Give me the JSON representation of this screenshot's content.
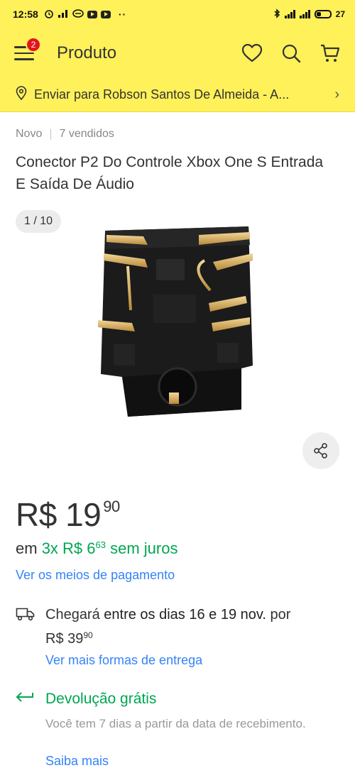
{
  "status_bar": {
    "time": "12:58",
    "battery": "27"
  },
  "header": {
    "menu_badge": "2",
    "title": "Produto"
  },
  "address": {
    "text": "Enviar para Robson Santos De Almeida - A...",
    "chevron": "›"
  },
  "product": {
    "condition": "Novo",
    "separator": "|",
    "sold": "7 vendidos",
    "title": "Conector P2 Do Controle Xbox One S Entrada E Saída De Áudio",
    "image_counter": "1 / 10"
  },
  "price": {
    "main": "R$ 19",
    "cents": "90"
  },
  "installments": {
    "prefix": "em ",
    "amount": "3x R$ 6",
    "cents": "63",
    "suffix": " sem juros"
  },
  "payment_link": "Ver os meios de pagamento",
  "delivery": {
    "prefix": "Chegará ",
    "dates": "entre os dias 16 e 19 nov.",
    "mid": " por",
    "price": "R$ 39",
    "cents": "90",
    "link": "Ver mais formas de entrega"
  },
  "returns": {
    "label": "Devolução grátis",
    "description": "Você tem 7 dias a partir da data de recebimento.",
    "link": "Saiba mais"
  },
  "icons": {
    "menu": "hamburger-icon",
    "favorite": "heart-icon",
    "search": "search-icon",
    "cart": "cart-icon",
    "location": "location-pin-icon",
    "share": "share-icon",
    "truck": "truck-icon",
    "return": "return-arrow-icon"
  },
  "colors": {
    "brand_yellow": "#fff159",
    "badge_red": "#e4141c",
    "link_blue": "#3483fa",
    "green": "#00a650"
  }
}
